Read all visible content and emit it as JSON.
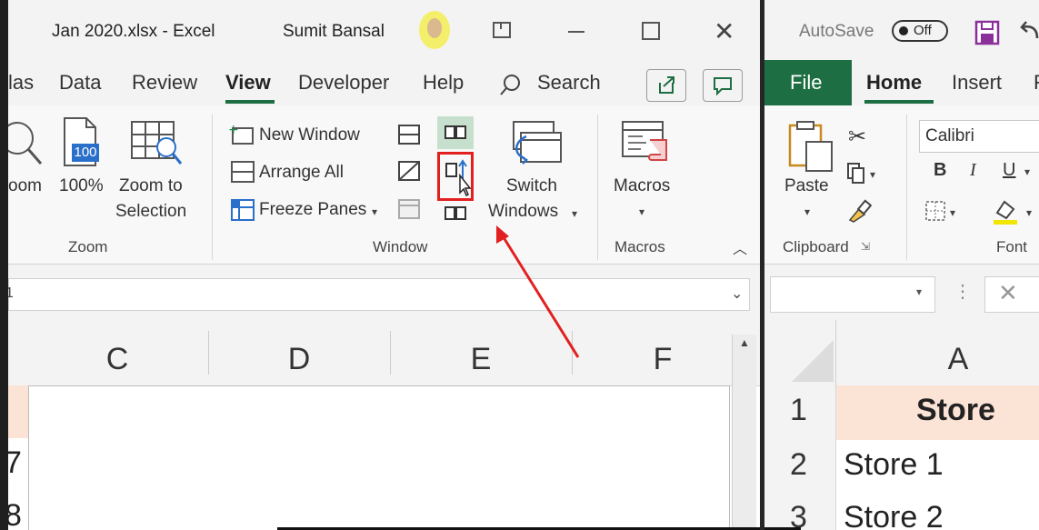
{
  "left_window": {
    "title": "Jan 2020.xlsx  -  Excel",
    "user": "Sumit Bansal",
    "tabs": [
      "las",
      "Data",
      "Review",
      "View",
      "Developer",
      "Help"
    ],
    "active_tab": "View",
    "search": "Search",
    "zoom_group": {
      "zoom_partial": "oom",
      "hundred": "100%",
      "hundred_badge": "100",
      "zoom_sel_1": "Zoom to",
      "zoom_sel_2": "Selection",
      "label": "Zoom"
    },
    "window_group": {
      "new_window": "New Window",
      "arrange_all": "Arrange All",
      "freeze_panes": "Freeze Panes",
      "switch_1": "Switch",
      "switch_2": "Windows",
      "label": "Window"
    },
    "macros_group": {
      "macros": "Macros",
      "label": "Macros"
    },
    "name_box_partial": "1",
    "columns": [
      "C",
      "D",
      "E",
      "F"
    ],
    "rows": [
      "7",
      "8"
    ]
  },
  "right_window": {
    "autosave": "AutoSave",
    "autosave_state": "Off",
    "tabs": [
      "File",
      "Home",
      "Insert",
      "F"
    ],
    "active_tab": "Home",
    "clipboard": {
      "paste": "Paste",
      "label": "Clipboard"
    },
    "font": {
      "name": "Calibri",
      "bold": "B",
      "italic": "I",
      "underline": "U",
      "label": "Font"
    },
    "column": "A",
    "rows": [
      {
        "num": "1",
        "value": "Store"
      },
      {
        "num": "2",
        "value": "Store 1"
      },
      {
        "num": "3",
        "value": "Store 2"
      }
    ]
  },
  "colors": {
    "file_tab": "#1e6e43",
    "header_fill": "#fbe3d6",
    "highlight": "#e32020",
    "selected_button": "#c7dfcd"
  }
}
